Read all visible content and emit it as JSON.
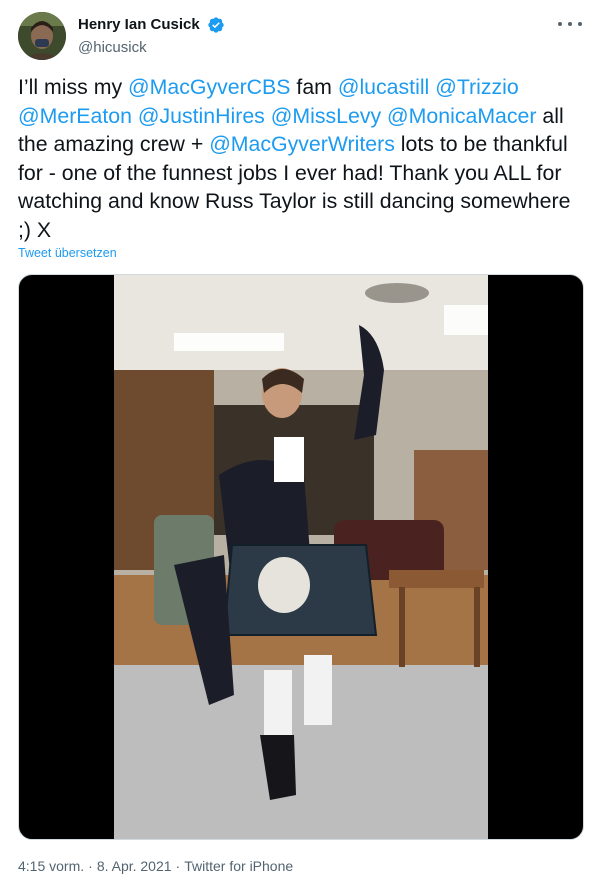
{
  "author": {
    "display_name": "Henry Ian Cusick",
    "handle": "@hicusick",
    "verified": true,
    "verified_icon": "verified-badge-icon",
    "avatar_icon": "avatar-photo"
  },
  "tweet": {
    "segments": [
      {
        "text": "I’ll miss my ",
        "type": "text"
      },
      {
        "text": "@MacGyverCBS",
        "type": "mention"
      },
      {
        "text": " fam ",
        "type": "text"
      },
      {
        "text": "@lucastill",
        "type": "mention"
      },
      {
        "text": " ",
        "type": "text"
      },
      {
        "text": "@Trizzio",
        "type": "mention"
      },
      {
        "text": " ",
        "type": "text"
      },
      {
        "text": "@MerEaton",
        "type": "mention"
      },
      {
        "text": " ",
        "type": "text"
      },
      {
        "text": "@JustinHires",
        "type": "mention"
      },
      {
        "text": " ",
        "type": "text"
      },
      {
        "text": "@MissLevy",
        "type": "mention"
      },
      {
        "text": " ",
        "type": "text"
      },
      {
        "text": "@MonicaMacer",
        "type": "mention"
      },
      {
        "text": " all the amazing crew + ",
        "type": "text"
      },
      {
        "text": "@MacGyverWriters",
        "type": "mention"
      },
      {
        "text": " lots to be thankful for - one of the funnest jobs I ever had! Thank you ALL for watching and know Russ Taylor is still dancing somewhere ;) X",
        "type": "text"
      }
    ],
    "translate_label": "Tweet übersetzen"
  },
  "media": {
    "type": "video",
    "icon": "video-still-icon"
  },
  "footer": {
    "time": "4:15 vorm.",
    "date": "8. Apr. 2021",
    "source": "Twitter for iPhone",
    "separator": "·"
  },
  "colors": {
    "accent": "#1d9bf0",
    "text": "#0f1419",
    "secondary": "#536471"
  }
}
